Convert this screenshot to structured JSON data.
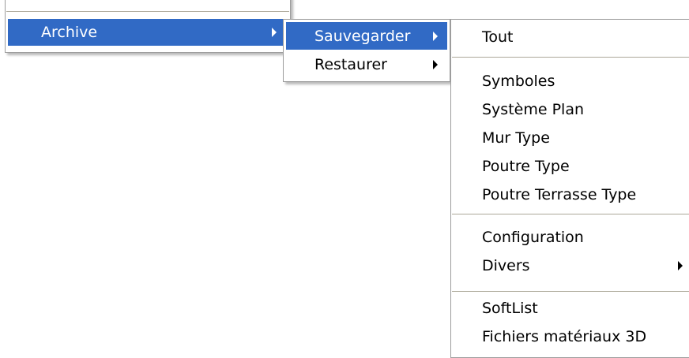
{
  "menus": {
    "main": {
      "archive_label": "Archive"
    },
    "archive_submenu": {
      "save_label": "Sauvegarder",
      "restore_label": "Restaurer"
    },
    "save_submenu": {
      "items": [
        "Tout",
        "Symboles",
        "Système Plan",
        "Mur Type",
        "Poutre Type",
        "Poutre Terrasse Type",
        "Configuration",
        "Divers",
        "SoftList",
        "Fichiers matériaux 3D"
      ]
    }
  },
  "colors": {
    "highlight": "#316ac5",
    "highlight_text": "#ffffff",
    "menu_background": "#ffffff",
    "separator": "#aca899"
  },
  "icons": {
    "submenu_arrow": "arrow-right-icon"
  }
}
